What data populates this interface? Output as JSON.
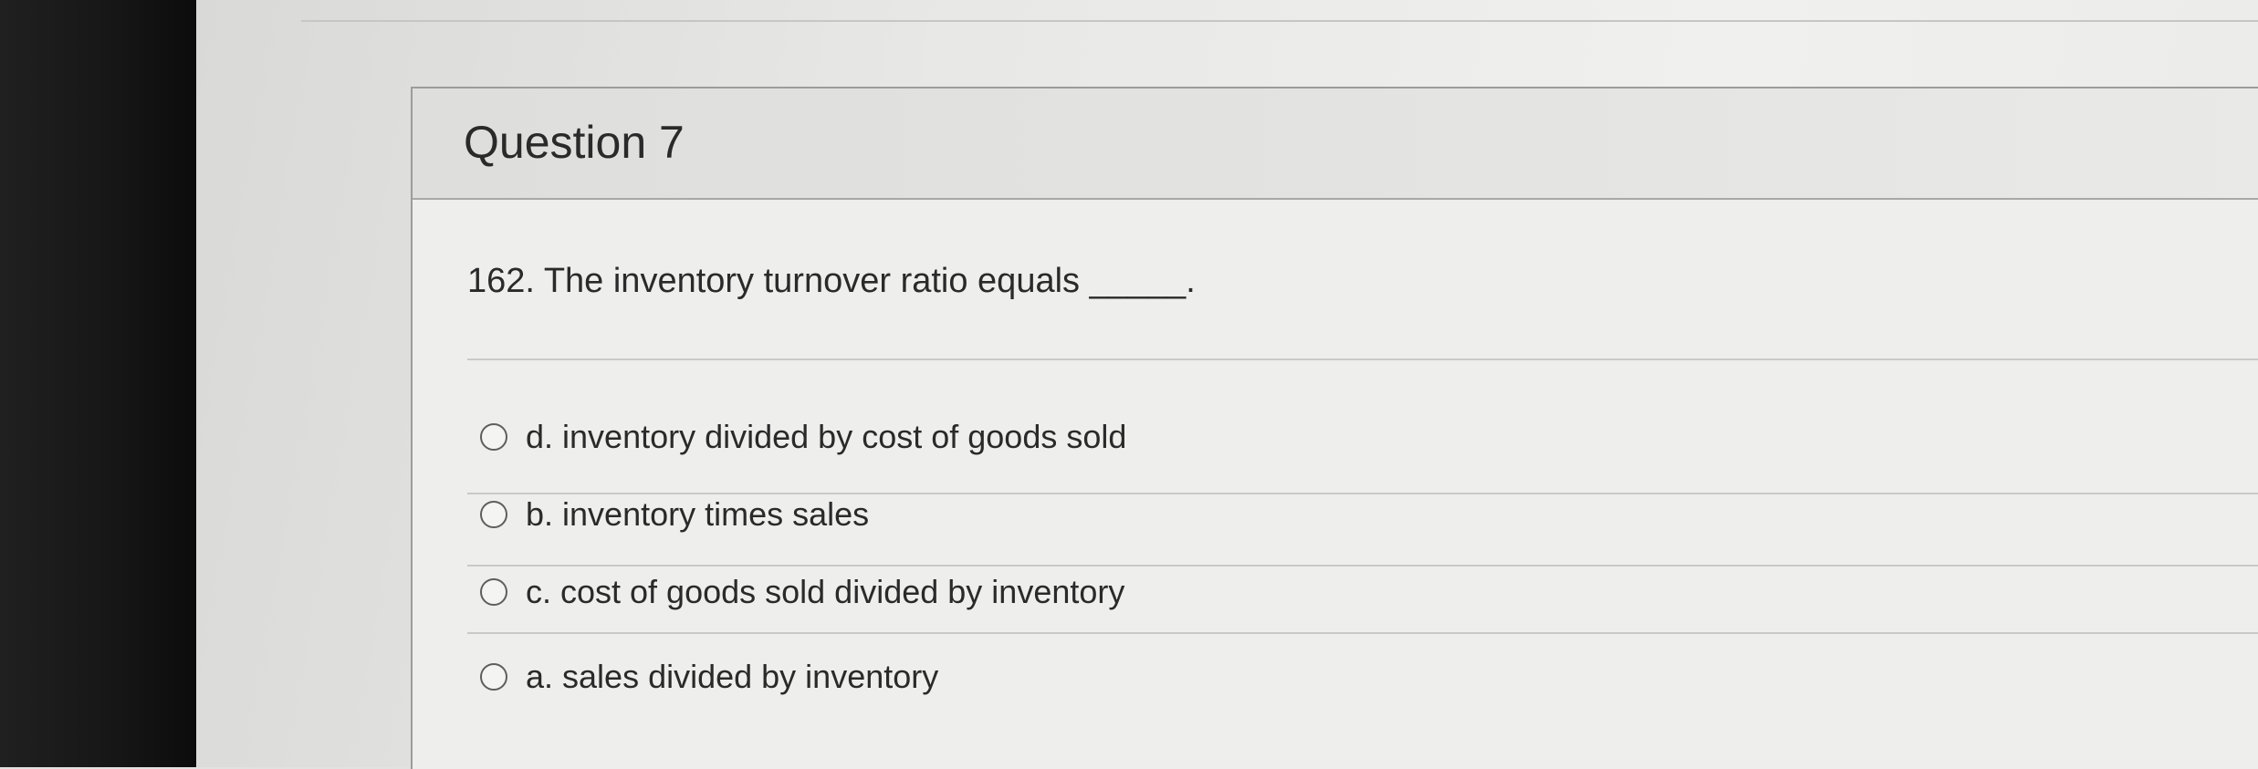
{
  "question": {
    "title": "Question 7",
    "text": "162. The inventory turnover ratio equals _____.",
    "choices": [
      {
        "label": "d. inventory divided by cost of goods sold",
        "selected": false
      },
      {
        "label": "b. inventory times sales",
        "selected": false
      },
      {
        "label": "c. cost of goods sold divided by inventory",
        "selected": false
      },
      {
        "label": "a. sales divided by inventory",
        "selected": false
      }
    ]
  }
}
